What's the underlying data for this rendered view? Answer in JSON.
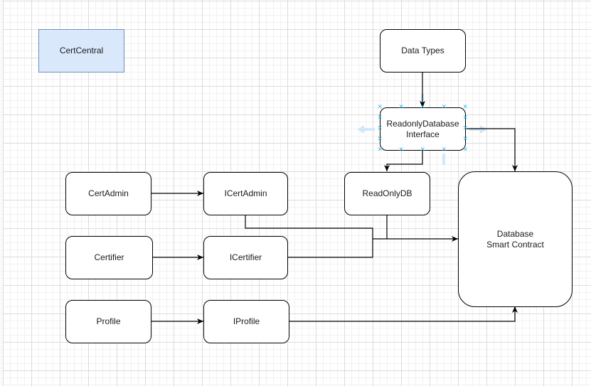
{
  "diagram": {
    "title": "CertCentral",
    "nodes": [
      {
        "id": "certcentral",
        "label": "CertCentral",
        "style": "filled-blue"
      },
      {
        "id": "data-types",
        "label": "Data Types"
      },
      {
        "id": "readonly-db-interface",
        "label": "ReadonlyDatabase\nInterface",
        "selected": true
      },
      {
        "id": "cert-admin",
        "label": "CertAdmin"
      },
      {
        "id": "i-cert-admin",
        "label": "ICertAdmin"
      },
      {
        "id": "read-only-db",
        "label": "ReadOnlyDB"
      },
      {
        "id": "certifier",
        "label": "Certifier"
      },
      {
        "id": "i-certifier",
        "label": "ICertifier"
      },
      {
        "id": "profile",
        "label": "Profile"
      },
      {
        "id": "i-profile",
        "label": "IProfile"
      },
      {
        "id": "database-smart-contract",
        "label": "Database\nSmart Contract"
      }
    ],
    "edges": [
      {
        "from": "data-types",
        "to": "readonly-db-interface"
      },
      {
        "from": "readonly-db-interface",
        "to": "read-only-db"
      },
      {
        "from": "readonly-db-interface",
        "to": "database-smart-contract"
      },
      {
        "from": "cert-admin",
        "to": "i-cert-admin"
      },
      {
        "from": "certifier",
        "to": "i-certifier"
      },
      {
        "from": "profile",
        "to": "i-profile"
      },
      {
        "from": "i-cert-admin",
        "to": "database-smart-contract"
      },
      {
        "from": "read-only-db",
        "to": "database-smart-contract"
      },
      {
        "from": "i-certifier",
        "to": "database-smart-contract"
      },
      {
        "from": "i-profile",
        "to": "database-smart-contract"
      }
    ],
    "colors": {
      "selection_handle": "#29b6f2",
      "hint_arrow": "#cfe8fb",
      "highlight_fill": "#dae8fc",
      "highlight_stroke": "#6c8ebf"
    }
  }
}
